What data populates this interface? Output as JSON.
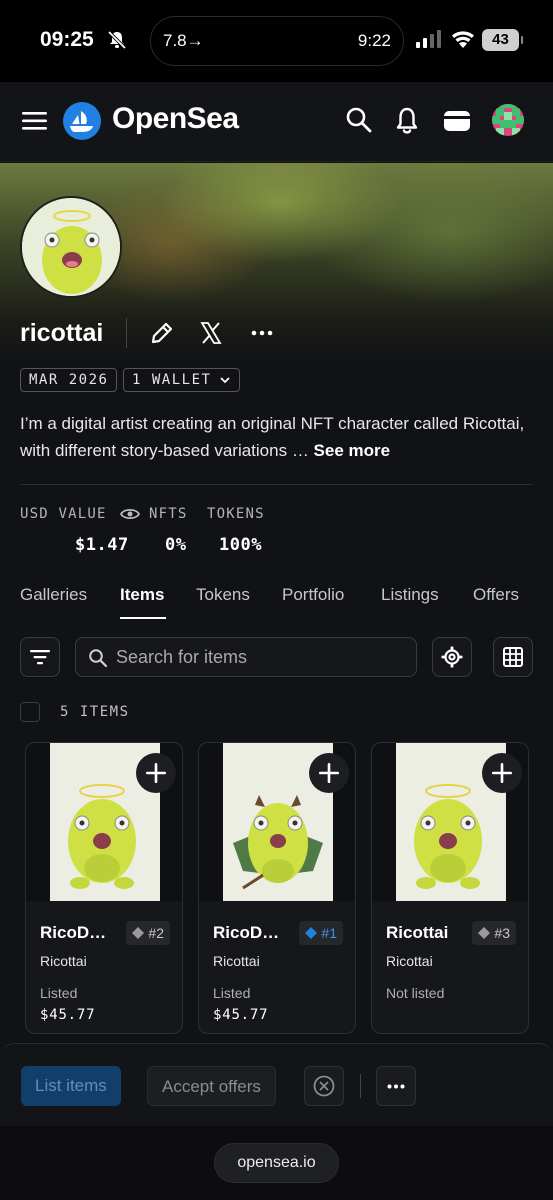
{
  "status_bar": {
    "time": "09:25",
    "island_left": "7.8→",
    "island_right": "9:22",
    "battery": "43"
  },
  "header": {
    "brand": "OpenSea",
    "brand_color": "#2081e2"
  },
  "profile": {
    "username": "ricottai",
    "chip_joined": "MAR 2026",
    "chip_wallet": "1 WALLET",
    "bio": "I’m a digital artist creating an original NFT character called Ricottai, with different story-based variations … ",
    "see_more": "See more"
  },
  "stats": [
    {
      "label": "USD VALUE",
      "value": "$1.47"
    },
    {
      "label": "NFTS",
      "value": "0%"
    },
    {
      "label": "TOKENS",
      "value": "100%"
    }
  ],
  "tabs": [
    "Galleries",
    "Items",
    "Tokens",
    "Portfolio",
    "Listings",
    "Offers"
  ],
  "active_tab": "Items",
  "search": {
    "placeholder": "Search for items"
  },
  "items_count": "5 ITEMS",
  "cards": [
    {
      "name": "RicoD…",
      "rank": "#2",
      "rank_color": "#9a9a9a",
      "collection": "Ricottai",
      "status": "Listed",
      "price": "$45.77"
    },
    {
      "name": "RicoD…",
      "rank": "#1",
      "rank_color": "#2081e2",
      "collection": "Ricottai",
      "status": "Listed",
      "price": "$45.77"
    },
    {
      "name": "Ricottai",
      "rank": "#3",
      "rank_color": "#9a9a9a",
      "collection": "Ricottai",
      "status": "Not listed",
      "price": ""
    }
  ],
  "action_bar": {
    "list_items": "List items",
    "accept_offers": "Accept offers"
  },
  "url": "opensea.io"
}
